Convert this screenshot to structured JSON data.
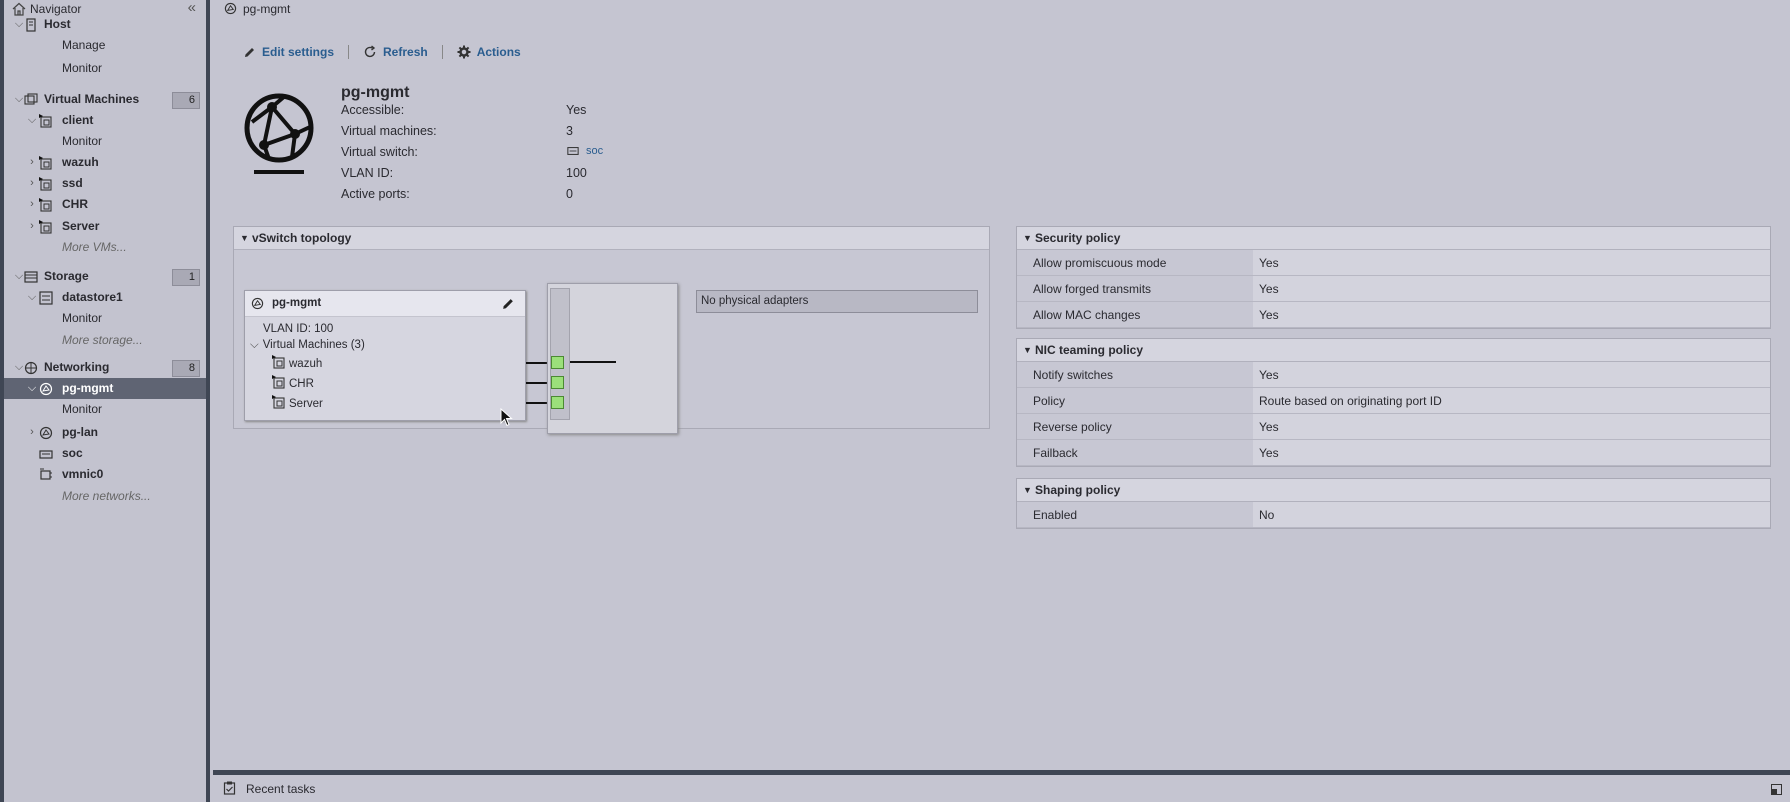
{
  "navigator": {
    "title": "Navigator",
    "collapse_glyph": "«",
    "items": [
      {
        "label": "Host",
        "icon": "host-icon",
        "chevron": "down",
        "style": "bold"
      },
      {
        "label": "Manage"
      },
      {
        "label": "Monitor"
      },
      {
        "label": "Virtual Machines",
        "icon": "vms-icon",
        "chevron": "down",
        "style": "bold",
        "badge": "6"
      },
      {
        "label": "client",
        "icon": "vm-icon",
        "chevron": "down",
        "style": "bold"
      },
      {
        "label": "Monitor"
      },
      {
        "label": "wazuh",
        "icon": "vm-icon",
        "chevron": "right",
        "style": "bold"
      },
      {
        "label": "ssd",
        "icon": "vm-icon",
        "chevron": "right",
        "style": "bold"
      },
      {
        "label": "CHR",
        "icon": "vm-icon",
        "chevron": "right",
        "style": "bold"
      },
      {
        "label": "Server",
        "icon": "vm-icon",
        "chevron": "right",
        "style": "bold"
      },
      {
        "label": "More VMs...",
        "style": "italic"
      },
      {
        "label": "Storage",
        "icon": "storage-icon",
        "chevron": "down",
        "style": "bold",
        "badge": "1"
      },
      {
        "label": "datastore1",
        "icon": "datastore-icon",
        "chevron": "down",
        "style": "bold"
      },
      {
        "label": "Monitor"
      },
      {
        "label": "More storage...",
        "style": "italic"
      },
      {
        "label": "Networking",
        "icon": "network-icon",
        "chevron": "down",
        "style": "bold",
        "badge": "8"
      },
      {
        "label": "pg-mgmt",
        "icon": "portgroup-icon",
        "chevron": "down",
        "style": "bold",
        "selected": true
      },
      {
        "label": "Monitor"
      },
      {
        "label": "pg-lan",
        "icon": "portgroup-icon",
        "chevron": "right",
        "style": "bold"
      },
      {
        "label": "soc",
        "icon": "switch-icon",
        "style": "bold"
      },
      {
        "label": "vmnic0",
        "icon": "nic-icon",
        "style": "bold"
      },
      {
        "label": "More networks...",
        "style": "italic"
      }
    ]
  },
  "page": {
    "title": "pg-mgmt",
    "toolbar": {
      "edit_label": "Edit settings",
      "refresh_label": "Refresh",
      "actions_label": "Actions"
    },
    "summary": {
      "name": "pg-mgmt",
      "rows": [
        {
          "key": "Accessible:",
          "value": "Yes"
        },
        {
          "key": "Virtual machines:",
          "value": "3"
        },
        {
          "key": "Virtual switch:",
          "value": "soc"
        },
        {
          "key": "VLAN ID:",
          "value": "100"
        },
        {
          "key": "Active ports:",
          "value": "0"
        }
      ]
    },
    "topology": {
      "title": "vSwitch topology",
      "portgroup_name": "pg-mgmt",
      "vlan_line": "VLAN ID: 100",
      "vms_line": "Virtual Machines (3)",
      "vms": [
        "wazuh",
        "CHR",
        "Server"
      ],
      "no_adapters": "No physical adapters"
    },
    "security_policy": {
      "title": "Security policy",
      "rows": [
        {
          "key": "Allow promiscuous mode",
          "value": "Yes"
        },
        {
          "key": "Allow forged transmits",
          "value": "Yes"
        },
        {
          "key": "Allow MAC changes",
          "value": "Yes"
        }
      ]
    },
    "nic_teaming": {
      "title": "NIC teaming policy",
      "rows": [
        {
          "key": "Notify switches",
          "value": "Yes"
        },
        {
          "key": "Policy",
          "value": "Route based on originating port ID"
        },
        {
          "key": "Reverse policy",
          "value": "Yes"
        },
        {
          "key": "Failback",
          "value": "Yes"
        }
      ]
    },
    "shaping": {
      "title": "Shaping policy",
      "rows": [
        {
          "key": "Enabled",
          "value": "No"
        }
      ]
    }
  },
  "bottom": {
    "recent_tasks_label": "Recent tasks"
  }
}
